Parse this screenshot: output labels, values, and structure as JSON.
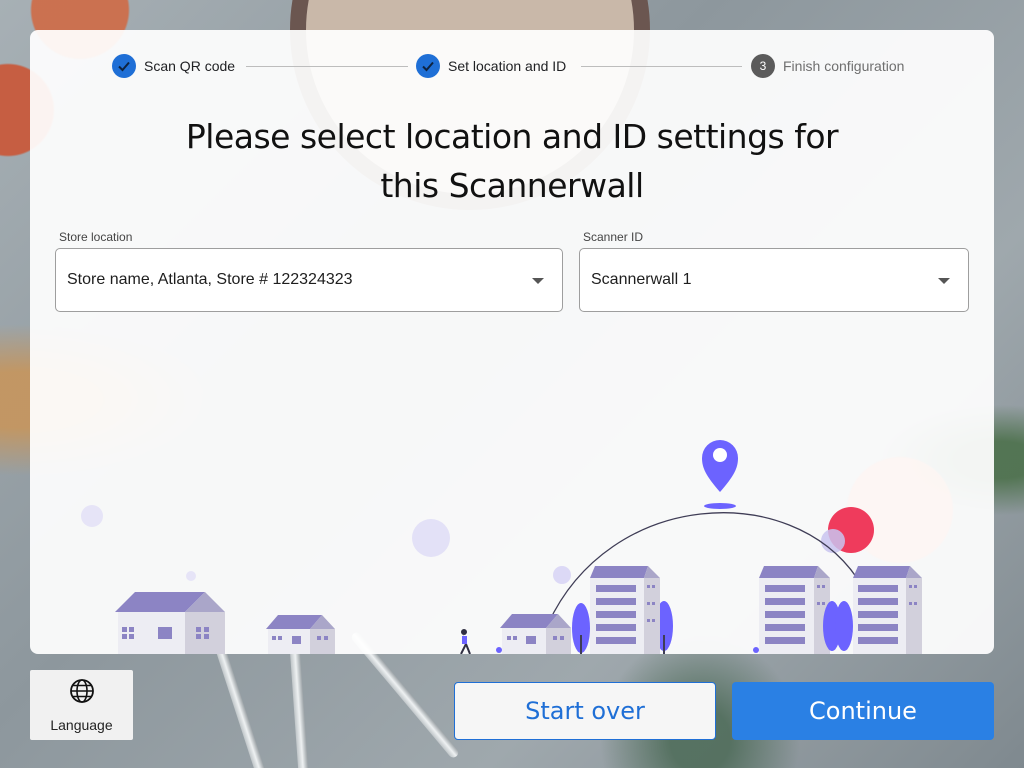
{
  "stepper": {
    "steps": [
      {
        "label": "Scan QR code",
        "state": "done"
      },
      {
        "label": "Set location and ID",
        "state": "done"
      },
      {
        "label": "Finish configuration",
        "state": "pending",
        "number": "3"
      }
    ]
  },
  "title": {
    "line1": "Please select location and ID settings for",
    "line2": "this Scannerwall"
  },
  "store_location": {
    "label": "Store location",
    "value": "Store name, Atlanta, Store # 122324323"
  },
  "scanner_id": {
    "label": "Scanner ID",
    "value": "Scannerwall 1"
  },
  "language_button": {
    "label": "Language",
    "icon": "globe-icon"
  },
  "actions": {
    "start_over": "Start over",
    "continue": "Continue"
  },
  "colors": {
    "primary": "#2a80e4",
    "step_done": "#1f6fd6",
    "illustration_accent": "#6c63ff",
    "building": "#8c84c4",
    "pin_red": "#ef3b5c"
  }
}
